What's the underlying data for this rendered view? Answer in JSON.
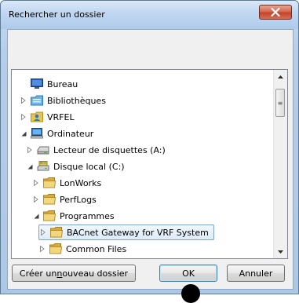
{
  "window": {
    "title": "Rechercher un dossier",
    "close_label": "X"
  },
  "tree": {
    "items": [
      {
        "label": "Bureau",
        "icon": "desktop-icon",
        "expander": "none",
        "selected": false
      },
      {
        "label": "Bibliothèques",
        "icon": "libraries-icon",
        "expander": "collapsed",
        "selected": false
      },
      {
        "label": "VRFEL",
        "icon": "user-folder-icon",
        "expander": "collapsed",
        "selected": false
      },
      {
        "label": "Ordinateur",
        "icon": "computer-icon",
        "expander": "expanded",
        "selected": false
      },
      {
        "label": "Lecteur de disquettes (A:)",
        "icon": "floppy-drive-icon",
        "expander": "collapsed",
        "selected": false
      },
      {
        "label": "Disque local (C:)",
        "icon": "local-disk-icon",
        "expander": "expanded",
        "selected": false
      },
      {
        "label": "LonWorks",
        "icon": "folder-icon",
        "expander": "collapsed",
        "selected": false
      },
      {
        "label": "PerfLogs",
        "icon": "folder-icon",
        "expander": "collapsed",
        "selected": false
      },
      {
        "label": "Programmes",
        "icon": "folder-icon",
        "expander": "expanded",
        "selected": false
      },
      {
        "label": "BACnet Gateway for VRF System",
        "icon": "folder-icon",
        "expander": "collapsed",
        "selected": true
      },
      {
        "label": "Common Files",
        "icon": "folder-icon",
        "expander": "collapsed",
        "selected": false
      }
    ]
  },
  "buttons": {
    "new_folder_prefix": "Créer un ",
    "new_folder_mnemonic": "n",
    "new_folder_suffix": "ouveau dossier",
    "ok": "OK",
    "cancel": "Annuler"
  },
  "colors": {
    "frame": "#adc8e6",
    "close_button": "#c2432a",
    "selection_border": "#7da2ce",
    "folder": "#e8c35a"
  }
}
